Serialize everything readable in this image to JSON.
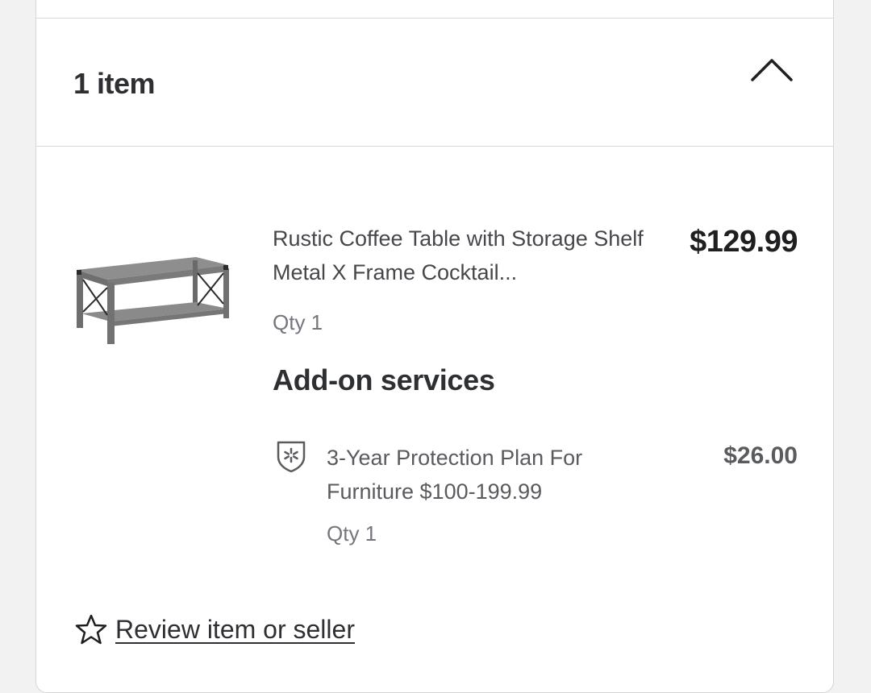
{
  "order_section": {
    "item_count_label": "1 item",
    "collapse_icon": "chevron-up-icon"
  },
  "product": {
    "image": "coffee-table-image",
    "name": "Rustic Coffee Table with Storage Shelf Metal X Frame Cocktail...",
    "price": "$129.99",
    "qty": "Qty 1"
  },
  "addons": {
    "heading": "Add-on services",
    "items": [
      {
        "icon": "shield-icon",
        "name": "3-Year Protection Plan For Furniture $100-199.99",
        "price": "$26.00",
        "qty": "Qty 1"
      }
    ]
  },
  "review": {
    "icon": "star-outline-icon",
    "label": "Review item or seller"
  },
  "colors": {
    "text_primary": "#2e2f32",
    "text_secondary": "#74767c",
    "divider": "#d8d8d8",
    "card_bg": "#ffffff",
    "page_bg": "#f2f2f2"
  }
}
